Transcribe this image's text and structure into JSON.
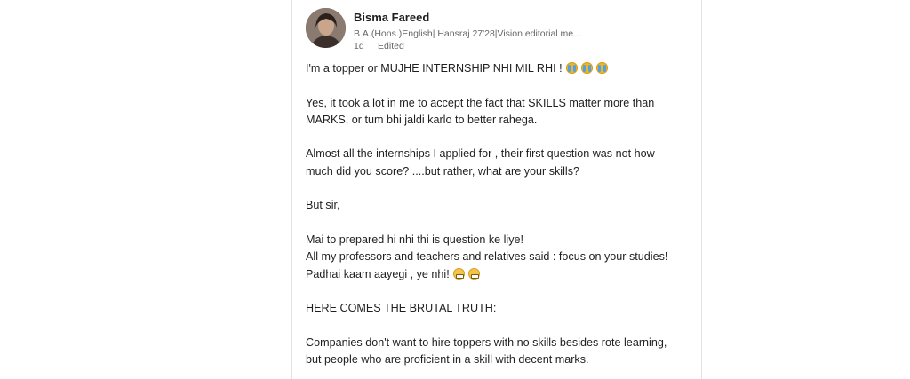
{
  "post": {
    "author": {
      "name": "Bisma Fareed",
      "headline": "B.A.(Hons.)English| Hansraj 27'28|Vision editorial me...",
      "age": "1d",
      "separator": "·",
      "edited_label": "Edited"
    },
    "body": {
      "p1": {
        "line1": "I'm a topper or MUJHE INTERNSHIP NHI MIL RHI !",
        "emojis": [
          "crying-face",
          "crying-face",
          "crying-face"
        ]
      },
      "p2": {
        "line1": "Yes, it took a lot in me to accept the fact that SKILLS matter more than",
        "line2": "MARKS, or tum bhi jaldi karlo to better rahega."
      },
      "p3": {
        "line1": "Almost all the internships I applied for , their first question was not how",
        "line2": "much did you score? ....but rather, what are your skills?"
      },
      "p4": {
        "line1": "But sir,"
      },
      "p5": {
        "line1": "Mai to prepared hi nhi thi is question ke liye!",
        "line2": "All my professors and teachers and relatives said : focus on your studies!",
        "line3": "Padhai kaam aayegi , ye nhi!",
        "emojis": [
          "grimacing-face",
          "grimacing-face"
        ]
      },
      "p6": {
        "line1": "HERE COMES THE BRUTAL TRUTH:"
      },
      "p7": {
        "line1": "Companies don't want to hire toppers with no skills besides rote learning,",
        "line2": "but people who are proficient in a skill with decent marks."
      }
    }
  },
  "colors": {
    "text_primary": "#1f1f1f",
    "text_secondary": "#666666",
    "divider": "#e3e3e3"
  }
}
